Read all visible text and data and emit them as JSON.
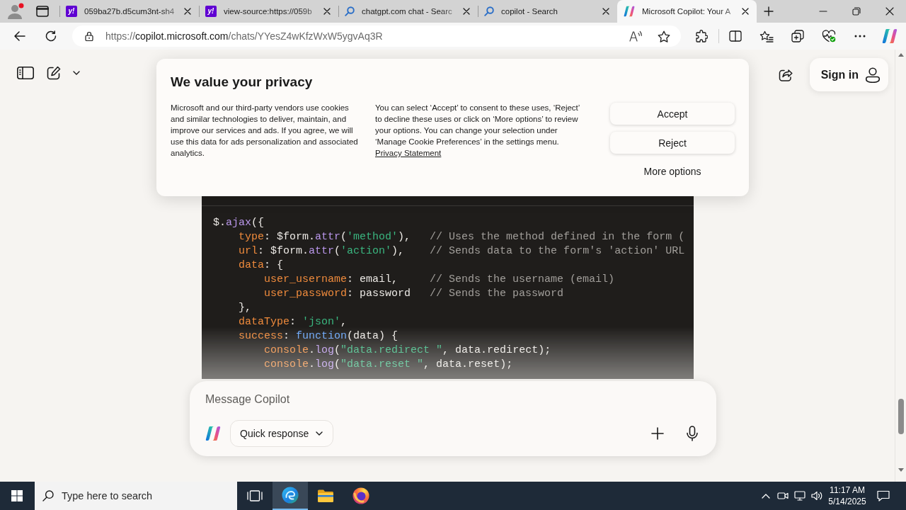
{
  "browser": {
    "tabs": [
      {
        "kind": "site",
        "favicon_text": "y!",
        "title": "059ba27b.d5cum3nt-sh4",
        "selected": false
      },
      {
        "kind": "site",
        "favicon_text": "y!",
        "title": "view-source:https://059b",
        "selected": false
      },
      {
        "kind": "search",
        "title": "chatgpt.com chat - Searc",
        "selected": false
      },
      {
        "kind": "search",
        "title": "copilot - Search",
        "selected": false
      },
      {
        "kind": "assistant",
        "title": "Microsoft Copilot: Your A",
        "selected": true
      }
    ],
    "address_bar": {
      "scheme": "https://",
      "host": "copilot.microsoft.com",
      "path": "/chats/YYesZ4wKfzWxW5ygvAq3R"
    }
  },
  "page": {
    "sign_in": "Sign in",
    "privacy_dialog": {
      "title": "We value your privacy",
      "description": "Microsoft and our third-party vendors use cookies and similar technologies to deliver, maintain, and improve our services and ads. If you agree, we will use this data for ads personalization and associated analytics.",
      "details": "You can select ‘Accept’ to consent to these uses, ‘Reject’ to decline these uses or click on ‘More options’ to review your options. You can change your selection under ‘Manage Cookie Preferences’ in the settings menu.",
      "link": "Privacy Statement",
      "buttons": [
        {
          "label": "Accept",
          "kind": "outlined"
        },
        {
          "label": "Reject",
          "kind": "outlined"
        },
        {
          "label": "More options",
          "kind": "link"
        }
      ]
    },
    "code_block": {
      "lines": [
        {
          "tokens": [
            {
              "text": "$.",
              "kind": "plain"
            },
            {
              "text": "ajax",
              "kind": "function"
            },
            {
              "text": "({",
              "kind": "plain"
            }
          ]
        },
        {
          "tokens": [
            {
              "text": "    type",
              "kind": "property"
            },
            {
              "text": ": $form.",
              "kind": "plain"
            },
            {
              "text": "attr",
              "kind": "function"
            },
            {
              "text": "(",
              "kind": "plain"
            },
            {
              "text": "'method'",
              "kind": "string"
            },
            {
              "text": "),   ",
              "kind": "plain"
            },
            {
              "text": "// Uses the method defined in the form (",
              "kind": "comment"
            }
          ]
        },
        {
          "tokens": [
            {
              "text": "    url",
              "kind": "property"
            },
            {
              "text": ": $form.",
              "kind": "plain"
            },
            {
              "text": "attr",
              "kind": "function"
            },
            {
              "text": "(",
              "kind": "plain"
            },
            {
              "text": "'action'",
              "kind": "string"
            },
            {
              "text": "),    ",
              "kind": "plain"
            },
            {
              "text": "// Sends data to the form's 'action' URL",
              "kind": "comment"
            }
          ]
        },
        {
          "tokens": [
            {
              "text": "    data",
              "kind": "property"
            },
            {
              "text": ": {",
              "kind": "plain"
            }
          ]
        },
        {
          "tokens": [
            {
              "text": "        user_username",
              "kind": "property"
            },
            {
              "text": ": email,     ",
              "kind": "plain"
            },
            {
              "text": "// Sends the username (email)",
              "kind": "comment"
            }
          ]
        },
        {
          "tokens": [
            {
              "text": "        user_password",
              "kind": "property"
            },
            {
              "text": ": password   ",
              "kind": "plain"
            },
            {
              "text": "// Sends the password",
              "kind": "comment"
            }
          ]
        },
        {
          "tokens": [
            {
              "text": "    },",
              "kind": "plain"
            }
          ]
        },
        {
          "tokens": [
            {
              "text": "    dataType",
              "kind": "property"
            },
            {
              "text": ": ",
              "kind": "plain"
            },
            {
              "text": "'json'",
              "kind": "string"
            },
            {
              "text": ",",
              "kind": "plain"
            }
          ]
        },
        {
          "tokens": [
            {
              "text": "    success",
              "kind": "property"
            },
            {
              "text": ": ",
              "kind": "plain"
            },
            {
              "text": "function",
              "kind": "keyword"
            },
            {
              "text": "(data) {",
              "kind": "plain"
            }
          ]
        },
        {
          "tokens": [
            {
              "text": "        console",
              "kind": "property"
            },
            {
              "text": ".",
              "kind": "plain"
            },
            {
              "text": "log",
              "kind": "function"
            },
            {
              "text": "(",
              "kind": "plain"
            },
            {
              "text": "\"data.redirect \"",
              "kind": "string"
            },
            {
              "text": ", data.redirect);",
              "kind": "plain"
            }
          ]
        },
        {
          "tokens": [
            {
              "text": "        console",
              "kind": "property"
            },
            {
              "text": ".",
              "kind": "plain"
            },
            {
              "text": "log",
              "kind": "function"
            },
            {
              "text": "(",
              "kind": "plain"
            },
            {
              "text": "\"data.reset \"",
              "kind": "string"
            },
            {
              "text": ", data.reset);",
              "kind": "plain"
            }
          ]
        }
      ]
    },
    "composer": {
      "placeholder": "Message Copilot",
      "mode": "Quick response"
    }
  },
  "taskbar": {
    "search_placeholder": "Type here to search",
    "apps": [
      {
        "kind": "task-view",
        "selected": false
      },
      {
        "kind": "wave-browser",
        "selected": true
      },
      {
        "kind": "folder",
        "selected": false
      },
      {
        "kind": "fox-browser",
        "selected": false
      }
    ],
    "clock": {
      "time": "11:17 AM",
      "date": "5/14/2025"
    }
  }
}
